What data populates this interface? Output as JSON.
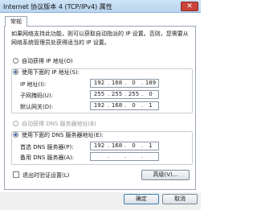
{
  "window": {
    "title": "Internet 协议版本 4 (TCP/IPv4) 属性",
    "close_glyph": "✕"
  },
  "tab": {
    "label": "常规"
  },
  "description": "如果网络支持此功能，则可以获取自动指派的 IP 设置。否则，您需要从网络系统管理员处获得适当的 IP 设置。",
  "ip": {
    "auto_label": "自动获得 IP 地址(O)",
    "manual_label": "使用下面的 IP 地址(S):",
    "mode": "manual",
    "fields": [
      {
        "label": "IP 地址(I):",
        "octets": [
          "192",
          "168",
          "0",
          "189"
        ]
      },
      {
        "label": "子网掩码(U):",
        "octets": [
          "255",
          "255",
          "255",
          "0"
        ]
      },
      {
        "label": "默认网关(D):",
        "octets": [
          "192",
          "168",
          "0",
          "1"
        ]
      }
    ]
  },
  "dns": {
    "auto_label": "自动获得 DNS 服务器地址(B)",
    "manual_label": "使用下面的 DNS 服务器地址(E):",
    "mode": "manual",
    "fields": [
      {
        "label": "首选 DNS 服务器(P):",
        "octets": [
          "192",
          "168",
          "0",
          "1"
        ]
      },
      {
        "label": "备用 DNS 服务器(A):",
        "octets": [
          "",
          "",
          "",
          ""
        ]
      }
    ]
  },
  "validate_label": "退出时验证设置(L)",
  "buttons": {
    "advanced": "高级(V)...",
    "ok": "确定",
    "cancel": "取消"
  },
  "colors": {
    "accent": "#1f4f9a",
    "close": "#c9453a"
  }
}
